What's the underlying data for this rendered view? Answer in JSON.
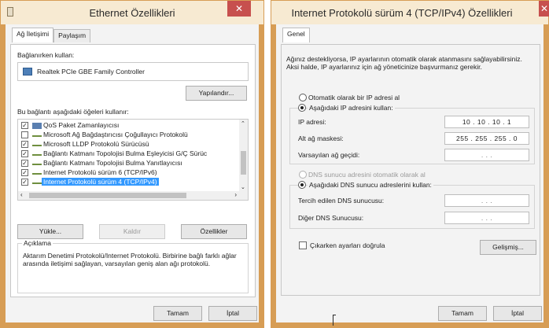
{
  "left_dialog": {
    "title": "Ethernet Özellikleri",
    "close_glyph": "✕",
    "tabs": [
      "Ağ İletişimi",
      "Paylaşım"
    ],
    "connect_using_label": "Bağlanırken kullan:",
    "adapter_name": "Realtek PCIe GBE Family Controller",
    "configure_button": "Yapılandır...",
    "items_label": "Bu bağlantı aşağıdaki öğeleri kullanır:",
    "items": [
      {
        "label": "QoS Paket Zamanlayıcısı",
        "checked": true,
        "icon": "qos-icon"
      },
      {
        "label": "Microsoft Ağ Bağdaştırıcısı Çoğullayıcı Protokolü",
        "checked": false,
        "icon": "protocol-icon"
      },
      {
        "label": "Microsoft LLDP Protokolü Sürücüsü",
        "checked": true,
        "icon": "protocol-icon"
      },
      {
        "label": "Bağlantı Katmanı Topolojisi Bulma Eşleyicisi G/Ç Sürüc",
        "checked": true,
        "icon": "protocol-icon"
      },
      {
        "label": "Bağlantı Katmanı Topolojisi Bulma Yanıtlayıcısı",
        "checked": true,
        "icon": "protocol-icon"
      },
      {
        "label": "Internet Protokolü sürüm 6 (TCP/IPv6)",
        "checked": true,
        "icon": "protocol-icon"
      },
      {
        "label": "Internet Protokolü sürüm 4 (TCP/IPv4)",
        "checked": true,
        "icon": "protocol-icon",
        "selected": true
      }
    ],
    "install_button": "Yükle...",
    "remove_button": "Kaldır",
    "properties_button": "Özellikler",
    "description_title": "Açıklama",
    "description_text": "Aktarım Denetimi Protokolü/Internet Protokolü. Birbirine bağlı farklı ağlar arasında iletişimi sağlayan, varsayılan geniş alan ağı protokolü.",
    "ok_button": "Tamam",
    "cancel_button": "İptal"
  },
  "right_dialog": {
    "title": "Internet Protokolü sürüm 4 (TCP/IPv4) Özellikleri",
    "tab": "Genel",
    "intro_text": "Ağınız destekliyorsa, IP ayarlarının otomatik olarak atanmasını sağlayabilirsiniz. Aksi halde, IP ayarlarınız için ağ yöneticinize başvurmanız gerekir.",
    "auto_ip_label": "Otomatik olarak bir IP adresi al",
    "manual_ip_label": "Aşağıdaki IP adresini kullan:",
    "ip_address_label": "IP adresi:",
    "ip_address_value": "10 . 10 . 10 . 1",
    "subnet_label": "Alt ağ maskesi:",
    "subnet_value": "255 . 255 . 255 . 0",
    "gateway_label": "Varsayılan ağ geçidi:",
    "gateway_value": ". . .",
    "auto_dns_label": "DNS sunucu adresini otomatik olarak al",
    "manual_dns_label": "Aşağıdaki DNS sunucu adreslerini kullan:",
    "preferred_dns_label": "Tercih edilen DNS sunucusu:",
    "preferred_dns_value": ". . .",
    "alternate_dns_label": "Diğer DNS Sunucusu:",
    "alternate_dns_value": ". . .",
    "validate_label": "Çıkarken ayarları doğrula",
    "advanced_button": "Gelişmiş...",
    "ok_button": "Tamam",
    "cancel_button": "İptal"
  },
  "colors": {
    "frame": "#d79d55",
    "titlebar": "#f7ead2",
    "close": "#c7504e",
    "selection": "#3399ff"
  }
}
